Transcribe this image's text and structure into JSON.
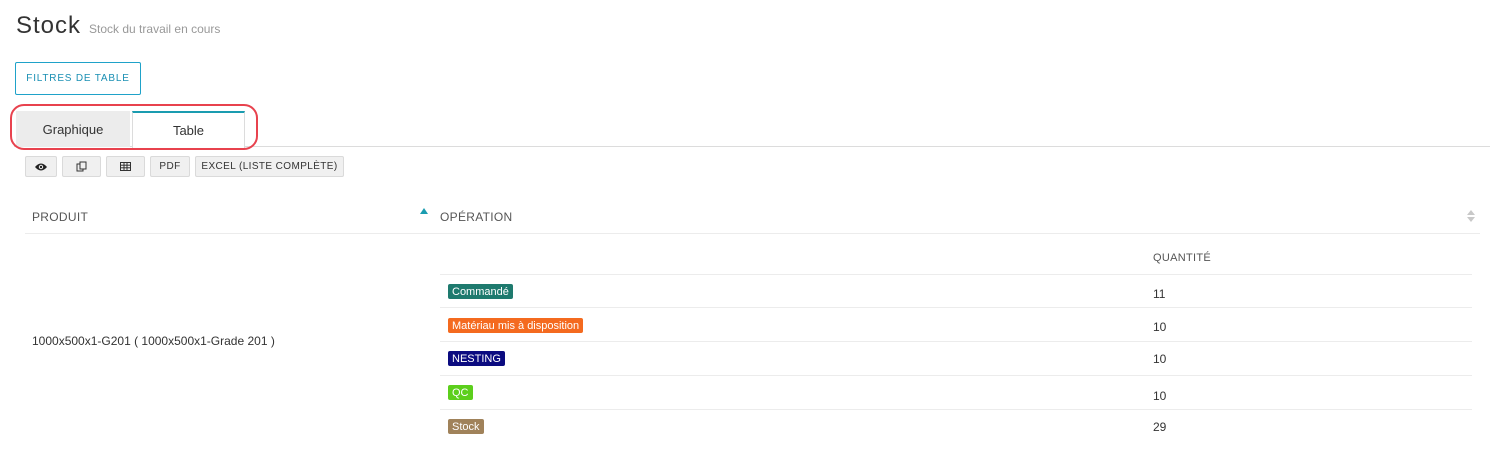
{
  "header": {
    "title": "Stock",
    "subtitle": "Stock du travail en cours"
  },
  "filters_button": "FILTRES DE TABLE",
  "tabs": [
    {
      "label": "Graphique",
      "active": false
    },
    {
      "label": "Table",
      "active": true
    }
  ],
  "toolbar": {
    "view_icon": "eye-icon",
    "copy_icon": "copy-icon",
    "columns_icon": "table-icon",
    "pdf_label": "PDF",
    "excel_label": "EXCEL (LISTE COMPLÈTE)"
  },
  "table": {
    "headers": {
      "product": "PRODUIT",
      "operation": "OPÉRATION"
    },
    "sub_header_quantity": "QUANTITÉ",
    "product": "1000x500x1-G201 ( 1000x500x1-Grade 201 )",
    "operations": [
      {
        "name": "Commandé",
        "quantity": "11",
        "color": "#1e7a6e"
      },
      {
        "name": "Matériau mis à disposition",
        "quantity": "10",
        "color": "#f46a1f"
      },
      {
        "name": "NESTING",
        "quantity": "10",
        "color": "#0b0b80"
      },
      {
        "name": "QC",
        "quantity": "10",
        "color": "#5ccf1c"
      },
      {
        "name": "Stock",
        "quantity": "29",
        "color": "#a0825a"
      }
    ]
  },
  "colors": {
    "accent": "#1a9cb0",
    "highlight": "#e8424e"
  }
}
